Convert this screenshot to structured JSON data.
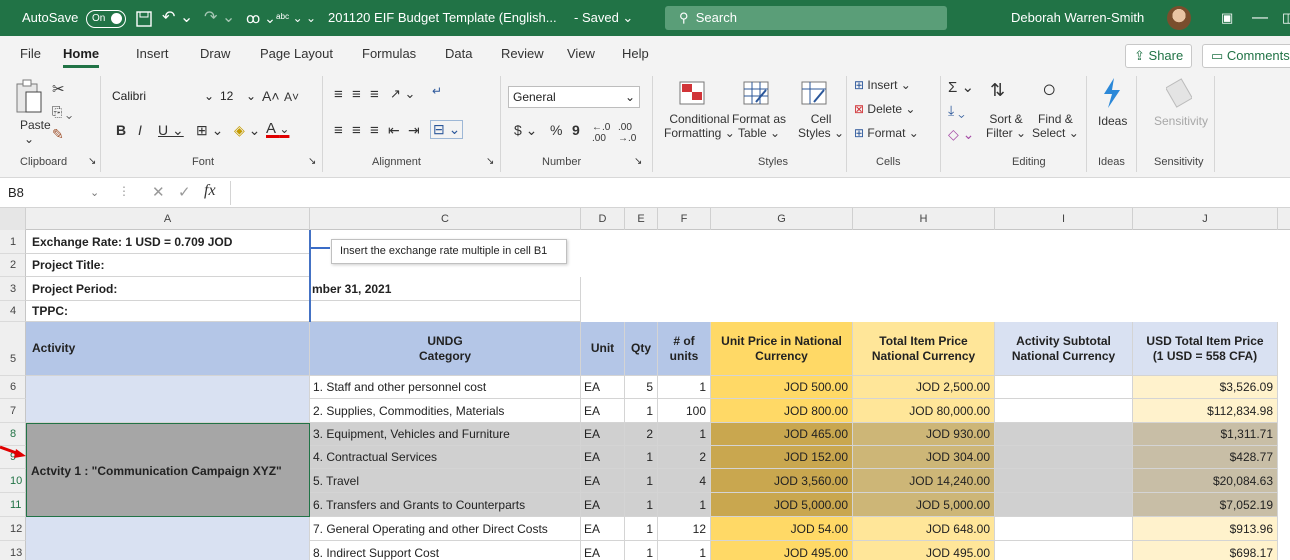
{
  "titlebar": {
    "autosave": "AutoSave",
    "toggle": "On",
    "filename": "201120 EIF Budget Template (English...",
    "saved": "- Saved",
    "search": "Search",
    "user": "Deborah Warren-Smith"
  },
  "tabs": [
    "File",
    "Home",
    "Insert",
    "Draw",
    "Page Layout",
    "Formulas",
    "Data",
    "Review",
    "View",
    "Help"
  ],
  "share": "Share",
  "comments": "Comments",
  "ribbon": {
    "paste": "Paste",
    "font_name": "Calibri",
    "font_size": "12",
    "number_format": "General",
    "clipboard": "Clipboard",
    "font": "Font",
    "alignment": "Alignment",
    "number": "Number",
    "styles": "Styles",
    "cells": "Cells",
    "editing": "Editing",
    "ideas": "Ideas",
    "sensitivity": "Sensitivity",
    "cond_fmt": [
      "Conditional",
      "Formatting"
    ],
    "fmt_table": [
      "Format as",
      "Table"
    ],
    "cell_styles": [
      "Cell",
      "Styles"
    ],
    "insert": "Insert",
    "delete": "Delete",
    "format": "Format",
    "sort": [
      "Sort &",
      "Filter"
    ],
    "find": [
      "Find &",
      "Select"
    ],
    "ideas_btn": "Ideas",
    "sensitivity_btn": "Sensitivity"
  },
  "namebox": "B8",
  "fx": "fx",
  "columns": [
    "A",
    "C",
    "D",
    "E",
    "F",
    "G",
    "H",
    "I",
    "J"
  ],
  "rows": [
    "1",
    "2",
    "3",
    "4",
    "5",
    "6",
    "7",
    "8",
    "9",
    "10",
    "11",
    "12",
    "13"
  ],
  "info": [
    "Exchange Rate: 1 USD = 0.709 JOD",
    "Project Title:",
    "Project Period:",
    "TPPC:"
  ],
  "period_tail": "mber 31, 2021",
  "comment": "Insert the exchange rate multiple in cell B1",
  "headers": {
    "activity": "Activity",
    "undg1": "UNDG",
    "undg2": "Category",
    "unit": "Unit",
    "qty": "Qty",
    "units1": "# of",
    "units2": "units",
    "unit_price1": "Unit Price in National",
    "unit_price2": "Currency",
    "total1": "Total Item Price",
    "total2": "National Currency",
    "subtotal1": "Activity Subtotal",
    "subtotal2": "National Currency",
    "usd1": "USD Total Item Price",
    "usd2": "(1 USD = 558 CFA)"
  },
  "activity_label": "Actvity 1 : \"Communication Campaign XYZ\"",
  "items": [
    {
      "cat": "1. Staff and other personnel cost",
      "unit": "EA",
      "qty": "5",
      "n": "1",
      "price": "JOD 500.00",
      "total": "JOD 2,500.00",
      "usd": "$3,526.09"
    },
    {
      "cat": "2. Supplies, Commodities, Materials",
      "unit": "EA",
      "qty": "1",
      "n": "100",
      "price": "JOD 800.00",
      "total": "JOD 80,000.00",
      "usd": "$112,834.98"
    },
    {
      "cat": "3. Equipment, Vehicles and Furniture",
      "unit": "EA",
      "qty": "2",
      "n": "1",
      "price": "JOD 465.00",
      "total": "JOD 930.00",
      "usd": "$1,311.71"
    },
    {
      "cat": "4. Contractual Services",
      "unit": "EA",
      "qty": "1",
      "n": "2",
      "price": "JOD 152.00",
      "total": "JOD 304.00",
      "usd": "$428.77"
    },
    {
      "cat": "5. Travel",
      "unit": "EA",
      "qty": "1",
      "n": "4",
      "price": "JOD 3,560.00",
      "total": "JOD 14,240.00",
      "usd": "$20,084.63"
    },
    {
      "cat": "6. Transfers and Grants to Counterparts",
      "unit": "EA",
      "qty": "1",
      "n": "1",
      "price": "JOD 5,000.00",
      "total": "JOD 5,000.00",
      "usd": "$7,052.19"
    },
    {
      "cat": "7. General Operating and other Direct Costs",
      "unit": "EA",
      "qty": "1",
      "n": "12",
      "price": "JOD 54.00",
      "total": "JOD 648.00",
      "usd": "$913.96"
    },
    {
      "cat": "8. Indirect Support Cost",
      "unit": "EA",
      "qty": "1",
      "n": "1",
      "price": "JOD 495.00",
      "total": "JOD 495.00",
      "usd": "$698.17"
    }
  ]
}
